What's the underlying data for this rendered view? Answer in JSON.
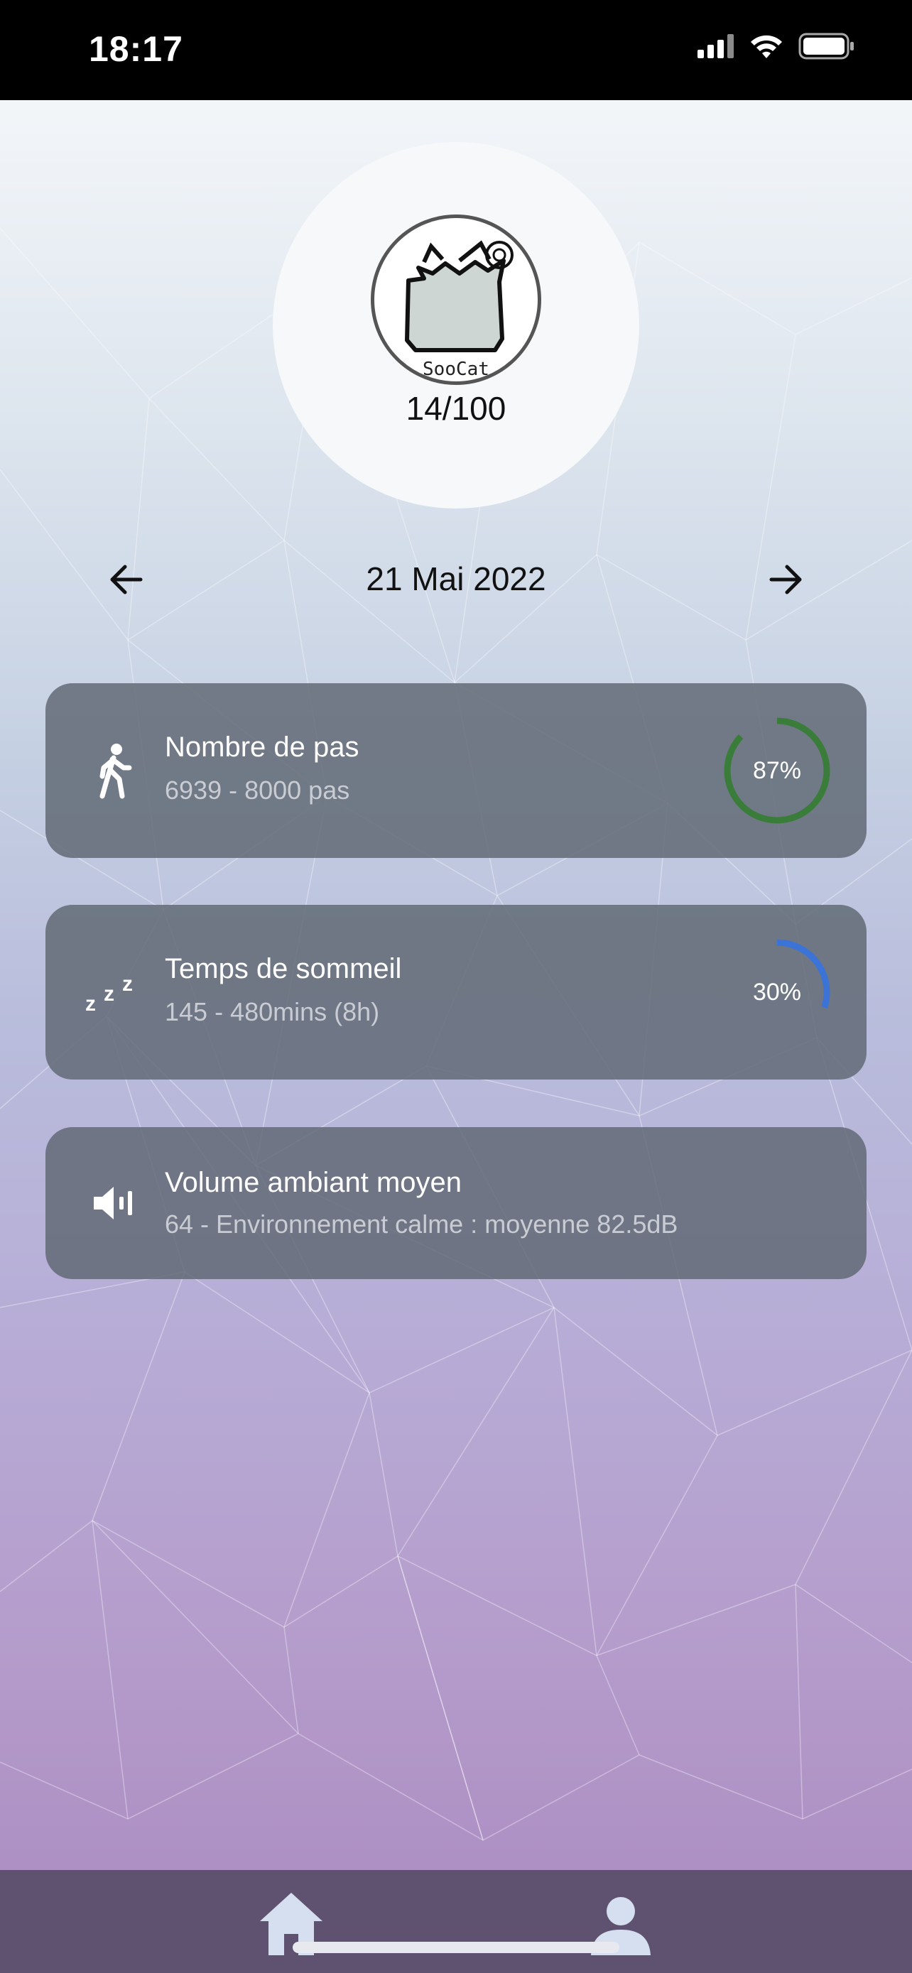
{
  "status_bar": {
    "time": "18:17"
  },
  "profile": {
    "logo_text": "SooCat",
    "score": "14/100"
  },
  "date_nav": {
    "date": "21 Mai 2022"
  },
  "cards": [
    {
      "title": "Nombre de pas",
      "subtitle": "6939 - 8000 pas",
      "percent_label": "87%",
      "progress": 0.87,
      "ring_color": "#3a7d3a",
      "icon": "walking-icon"
    },
    {
      "title": "Temps de sommeil",
      "subtitle": "145 - 480mins (8h)",
      "percent_label": "30%",
      "progress": 0.3,
      "ring_color": "#3b73d6",
      "icon": "sleep-zzz-icon"
    },
    {
      "title": "Volume ambiant moyen",
      "subtitle": "64 - Environnement calme : moyenne 82.5dB",
      "icon": "volume-icon"
    }
  ],
  "bottom_nav": {
    "items": [
      "home-icon",
      "profile-icon"
    ]
  },
  "colors": {
    "card_bg": "#626a76",
    "nav_bg": "#5f5270"
  }
}
